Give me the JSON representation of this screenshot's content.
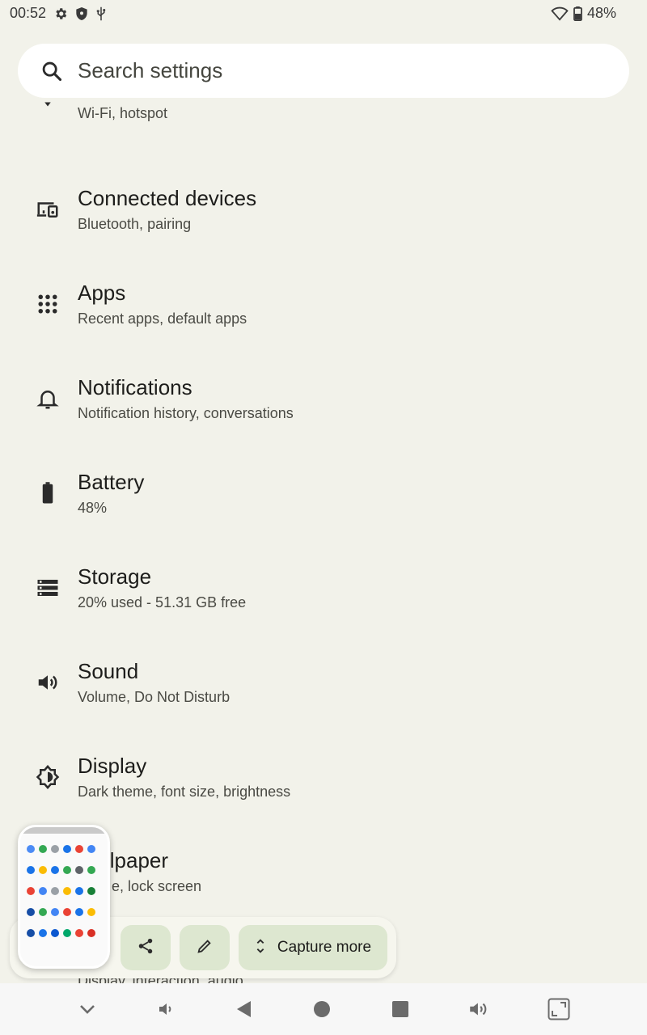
{
  "status_bar": {
    "time": "00:52",
    "battery": "48%"
  },
  "search": {
    "placeholder": "Search settings"
  },
  "items": [
    {
      "title": "",
      "subtitle": "Wi-Fi, hotspot",
      "icon": "wifi-icon"
    },
    {
      "title": "Connected devices",
      "subtitle": "Bluetooth, pairing",
      "icon": "devices-icon"
    },
    {
      "title": "Apps",
      "subtitle": "Recent apps, default apps",
      "icon": "apps-grid-icon"
    },
    {
      "title": "Notifications",
      "subtitle": "Notification history, conversations",
      "icon": "bell-icon"
    },
    {
      "title": "Battery",
      "subtitle": "48%",
      "icon": "battery-icon"
    },
    {
      "title": "Storage",
      "subtitle": "20% used - 51.31 GB free",
      "icon": "storage-icon"
    },
    {
      "title": "Sound",
      "subtitle": "Volume, Do Not Disturb",
      "icon": "speaker-icon"
    },
    {
      "title": "Display",
      "subtitle": "Dark theme, font size, brightness",
      "icon": "brightness-icon"
    },
    {
      "title": "llpaper",
      "subtitle": "e, lock screen",
      "icon": "wallpaper-icon"
    },
    {
      "title": "",
      "subtitle": "Display, interaction, audio",
      "icon": "accessibility-icon"
    }
  ],
  "screenshot_actions": {
    "capture_more_label": "Capture more"
  },
  "colors": {
    "background": "#f2f2ea",
    "button_bg": "#dde7d0",
    "search_bg": "#ffffff"
  }
}
